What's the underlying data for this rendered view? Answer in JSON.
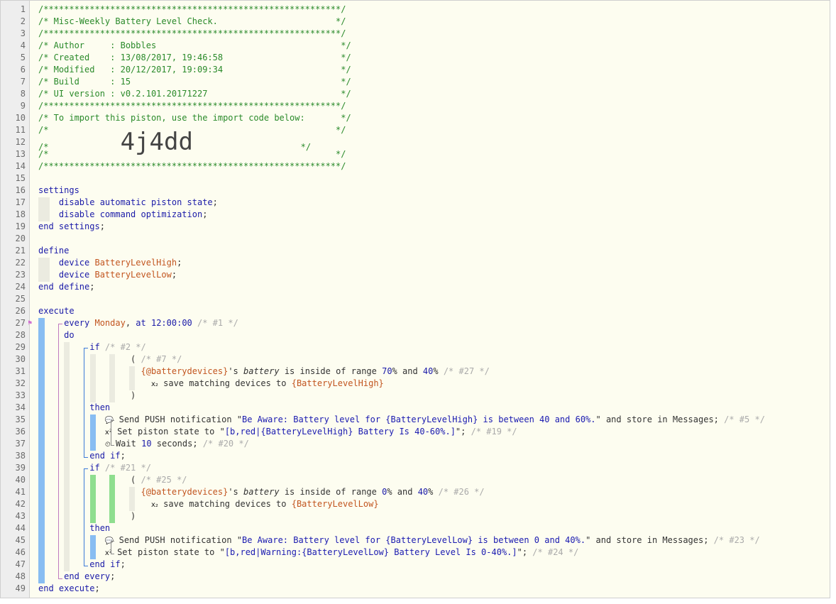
{
  "code_lines": [
    {
      "n": "1",
      "segs": [
        [
          "comment",
          "/**********************************************************/"
        ]
      ]
    },
    {
      "n": "2",
      "segs": [
        [
          "comment",
          "/* Misc-Weekly Battery Level Check.                       */"
        ]
      ]
    },
    {
      "n": "3",
      "segs": [
        [
          "comment",
          "/**********************************************************/"
        ]
      ]
    },
    {
      "n": "4",
      "segs": [
        [
          "comment",
          "/* Author     : Bobbles                                    */"
        ]
      ]
    },
    {
      "n": "5",
      "segs": [
        [
          "comment",
          "/* Created    : 13/08/2017, 19:46:58                       */"
        ]
      ]
    },
    {
      "n": "6",
      "segs": [
        [
          "comment",
          "/* Modified   : 20/12/2017, 19:09:34                       */"
        ]
      ]
    },
    {
      "n": "7",
      "segs": [
        [
          "comment",
          "/* Build      : 15                                         */"
        ]
      ]
    },
    {
      "n": "8",
      "segs": [
        [
          "comment",
          "/* UI version : v0.2.101.20171227                          */"
        ]
      ]
    },
    {
      "n": "9",
      "segs": [
        [
          "comment",
          "/**********************************************************/"
        ]
      ]
    },
    {
      "n": "10",
      "segs": [
        [
          "comment",
          "/* To import this piston, use the import code below:       */"
        ]
      ]
    },
    {
      "n": "11",
      "segs": [
        [
          "comment",
          "/*                                                        */"
        ]
      ]
    },
    {
      "n": "12",
      "segs": [
        [
          "comment",
          "/*              "
        ],
        [
          "big",
          "4j4dd"
        ],
        [
          "comment",
          "                     */"
        ]
      ]
    },
    {
      "n": "13",
      "segs": [
        [
          "comment",
          "/*                                                        */"
        ]
      ]
    },
    {
      "n": "14",
      "segs": [
        [
          "comment",
          "/**********************************************************/"
        ]
      ]
    },
    {
      "n": "15",
      "segs": []
    },
    {
      "n": "16",
      "segs": [
        [
          "kw",
          "settings"
        ]
      ]
    },
    {
      "n": "17",
      "segs": [
        [
          "plain",
          "    "
        ],
        [
          "kw",
          "disable automatic piston state"
        ],
        [
          "plain",
          ";"
        ]
      ]
    },
    {
      "n": "18",
      "segs": [
        [
          "plain",
          "    "
        ],
        [
          "kw",
          "disable command optimization"
        ],
        [
          "plain",
          ";"
        ]
      ]
    },
    {
      "n": "19",
      "segs": [
        [
          "kw",
          "end settings"
        ],
        [
          "plain",
          ";"
        ]
      ]
    },
    {
      "n": "20",
      "segs": []
    },
    {
      "n": "21",
      "segs": [
        [
          "kw",
          "define"
        ]
      ]
    },
    {
      "n": "22",
      "segs": [
        [
          "plain",
          "    "
        ],
        [
          "kw",
          "device "
        ],
        [
          "var",
          "BatteryLevelHigh"
        ],
        [
          "plain",
          ";"
        ]
      ]
    },
    {
      "n": "23",
      "segs": [
        [
          "plain",
          "    "
        ],
        [
          "kw",
          "device "
        ],
        [
          "var",
          "BatteryLevelLow"
        ],
        [
          "plain",
          ";"
        ]
      ]
    },
    {
      "n": "24",
      "segs": [
        [
          "kw",
          "end define"
        ],
        [
          "plain",
          ";"
        ]
      ]
    },
    {
      "n": "25",
      "segs": []
    },
    {
      "n": "26",
      "segs": [
        [
          "kw",
          "execute"
        ]
      ]
    },
    {
      "n": "27",
      "segs": [
        [
          "plain",
          "     "
        ],
        [
          "kw",
          "every "
        ],
        [
          "var",
          "Monday"
        ],
        [
          "plain",
          ", "
        ],
        [
          "kw",
          "at "
        ],
        [
          "num",
          "12:00:00"
        ],
        [
          "dim",
          " /* #1 */"
        ]
      ]
    },
    {
      "n": "28",
      "segs": [
        [
          "plain",
          "     "
        ],
        [
          "kw",
          "do"
        ]
      ]
    },
    {
      "n": "29",
      "segs": [
        [
          "plain",
          "          "
        ],
        [
          "kw",
          "if"
        ],
        [
          "dim",
          " /* #2 */"
        ]
      ]
    },
    {
      "n": "30",
      "segs": [
        [
          "plain",
          "                  ( "
        ],
        [
          "dim",
          "/* #7 */"
        ]
      ]
    },
    {
      "n": "31",
      "segs": [
        [
          "plain",
          "                    "
        ],
        [
          "var",
          "{@batterydevices}"
        ],
        [
          "plain",
          "'s "
        ],
        [
          "italic",
          "battery"
        ],
        [
          "plain",
          " is inside of range "
        ],
        [
          "num",
          "70"
        ],
        [
          "plain",
          "% and "
        ],
        [
          "num",
          "40"
        ],
        [
          "plain",
          "%"
        ],
        [
          "dim",
          " /* #27 */"
        ]
      ]
    },
    {
      "n": "32",
      "segs": [
        [
          "plain",
          "                      "
        ],
        [
          "icon",
          "x₂"
        ],
        [
          "plain",
          " save matching devices to "
        ],
        [
          "var",
          "{BatteryLevelHigh}"
        ]
      ]
    },
    {
      "n": "33",
      "segs": [
        [
          "plain",
          "                  )"
        ]
      ]
    },
    {
      "n": "34",
      "segs": [
        [
          "plain",
          "          "
        ],
        [
          "kw",
          "then"
        ]
      ]
    },
    {
      "n": "35",
      "segs": [
        [
          "plain",
          "             "
        ],
        [
          "icon",
          "💬"
        ],
        [
          "plain",
          " Send PUSH notification \""
        ],
        [
          "str",
          "Be Aware: Battery level for {BatteryLevelHigh} is between 40 and 60%."
        ],
        [
          "plain",
          "\" and store in Messages;"
        ],
        [
          "dim",
          " /* #5 */"
        ]
      ]
    },
    {
      "n": "36",
      "segs": [
        [
          "plain",
          "             "
        ],
        [
          "icon",
          "x²"
        ],
        [
          "plain",
          " Set piston state to \""
        ],
        [
          "str",
          "[b,red|{BatteryLevelHigh} Battery Is 40-60%.]"
        ],
        [
          "plain",
          "\";"
        ],
        [
          "dim",
          " /* #19 */"
        ]
      ]
    },
    {
      "n": "37",
      "segs": [
        [
          "plain",
          "             "
        ],
        [
          "icon",
          "⏲"
        ],
        [
          "plain",
          " Wait "
        ],
        [
          "num",
          "10"
        ],
        [
          "plain",
          " seconds;"
        ],
        [
          "dim",
          " /* #20 */"
        ]
      ]
    },
    {
      "n": "38",
      "segs": [
        [
          "plain",
          "          "
        ],
        [
          "kw",
          "end if"
        ],
        [
          "plain",
          ";"
        ]
      ]
    },
    {
      "n": "39",
      "segs": [
        [
          "plain",
          "          "
        ],
        [
          "kw",
          "if"
        ],
        [
          "dim",
          " /* #21 */"
        ]
      ]
    },
    {
      "n": "40",
      "segs": [
        [
          "plain",
          "                  ( "
        ],
        [
          "dim",
          "/* #25 */"
        ]
      ]
    },
    {
      "n": "41",
      "segs": [
        [
          "plain",
          "                    "
        ],
        [
          "var",
          "{@batterydevices}"
        ],
        [
          "plain",
          "'s "
        ],
        [
          "italic",
          "battery"
        ],
        [
          "plain",
          " is inside of range "
        ],
        [
          "num",
          "0"
        ],
        [
          "plain",
          "% and "
        ],
        [
          "num",
          "40"
        ],
        [
          "plain",
          "%"
        ],
        [
          "dim",
          " /* #26 */"
        ]
      ]
    },
    {
      "n": "42",
      "segs": [
        [
          "plain",
          "                      "
        ],
        [
          "icon",
          "x₂"
        ],
        [
          "plain",
          " save matching devices to "
        ],
        [
          "var",
          "{BatteryLevelLow}"
        ]
      ]
    },
    {
      "n": "43",
      "segs": [
        [
          "plain",
          "                  )"
        ]
      ]
    },
    {
      "n": "44",
      "segs": [
        [
          "plain",
          "          "
        ],
        [
          "kw",
          "then"
        ]
      ]
    },
    {
      "n": "45",
      "segs": [
        [
          "plain",
          "             "
        ],
        [
          "icon",
          "💬"
        ],
        [
          "plain",
          " Send PUSH notification \""
        ],
        [
          "str",
          "Be Aware: Battery level for {BatteryLevelLow} is between 0 and 40%."
        ],
        [
          "plain",
          "\" and store in Messages;"
        ],
        [
          "dim",
          " /* #23 */"
        ]
      ]
    },
    {
      "n": "46",
      "segs": [
        [
          "plain",
          "             "
        ],
        [
          "icon",
          "x²"
        ],
        [
          "plain",
          " Set piston state to \""
        ],
        [
          "str",
          "[b,red|Warning:{BatteryLevelLow} Battery Level Is 0-40%.]"
        ],
        [
          "plain",
          "\";"
        ],
        [
          "dim",
          " /* #24 */"
        ]
      ]
    },
    {
      "n": "47",
      "segs": [
        [
          "plain",
          "          "
        ],
        [
          "kw",
          "end if"
        ],
        [
          "plain",
          ";"
        ]
      ]
    },
    {
      "n": "48",
      "segs": [
        [
          "plain",
          "     "
        ],
        [
          "kw",
          "end every"
        ],
        [
          "plain",
          ";"
        ]
      ]
    },
    {
      "n": "49",
      "segs": [
        [
          "kw",
          "end execute"
        ],
        [
          "plain",
          ";"
        ]
      ]
    }
  ],
  "flag_line": "27",
  "flag_icon": "flag-icon",
  "colors": {
    "comment": "#2a8a2a",
    "keyword": "#1a1aa8",
    "variable": "#c2551f",
    "blue_bar": "#88bdf2",
    "green_bar": "#8fde8f"
  }
}
